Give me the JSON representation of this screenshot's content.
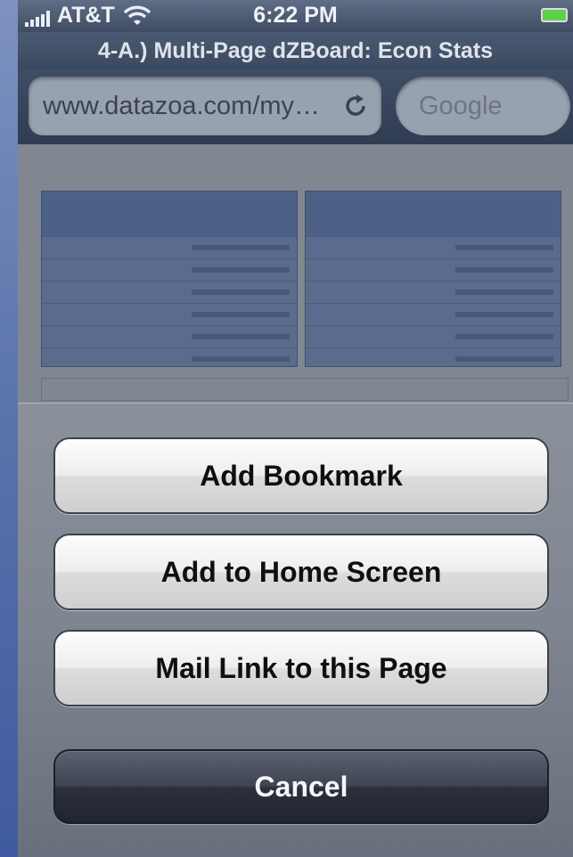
{
  "status_bar": {
    "carrier": "AT&T",
    "time": "6:22 PM"
  },
  "browser": {
    "page_title": "4-A.) Multi-Page dZBoard: Econ Stats",
    "url": "www.datazoa.com/my…",
    "search_placeholder": "Google"
  },
  "action_sheet": {
    "add_bookmark": "Add Bookmark",
    "add_home": "Add to Home Screen",
    "mail_link": "Mail Link to this Page",
    "cancel": "Cancel"
  }
}
